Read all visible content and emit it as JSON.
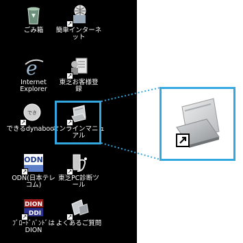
{
  "desktop": {
    "icons": [
      {
        "name": "recycle-bin",
        "label": "ごみ箱"
      },
      {
        "name": "easy-internet",
        "label": "簡単インターネ\nット"
      },
      {
        "name": "internet-explorer",
        "label": "Internet\nExplorer"
      },
      {
        "name": "toshiba-registration",
        "label": "東芝お客様登\n録"
      },
      {
        "name": "dekiru-dynabook",
        "label": "できるdynabook"
      },
      {
        "name": "online-manual",
        "label": "オンラインマニュ\nアル"
      },
      {
        "name": "odn",
        "label": "ODN(日本テレ\nコム)"
      },
      {
        "name": "toshiba-pc-diagnostic",
        "label": "東芝PC診断ツ\nール"
      },
      {
        "name": "dion-broadband",
        "label": "ﾌﾞﾛｰﾄﾞﾊﾞﾝﾄﾞは\nDION"
      },
      {
        "name": "faq",
        "label": "よくあるご質問"
      }
    ],
    "logos": {
      "odn": "ODN",
      "dion_top": "DION",
      "dion_bottom": "DDI"
    }
  },
  "highlight_color": "#33a7e0",
  "shortcut_arrow": "↗"
}
